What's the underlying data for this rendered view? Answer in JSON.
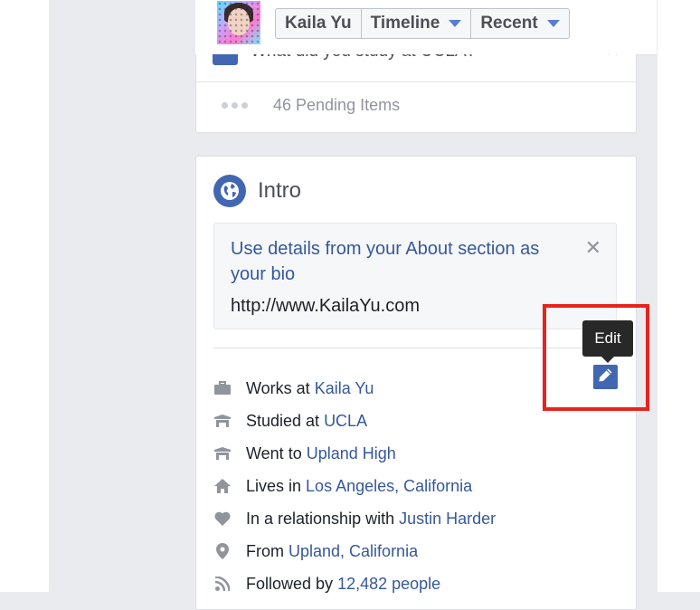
{
  "header": {
    "profile_name": "Kaila Yu",
    "timeline_label": "Timeline",
    "recent_label": "Recent"
  },
  "composer": {
    "cutoff_prompt": "What did you study at UCLA?",
    "pending_items": "46 Pending Items"
  },
  "intro": {
    "title": "Intro",
    "bio_suggestion": "Use details from your About section as your bio",
    "bio_url": "http://www.KailaYu.com",
    "edit_tooltip": "Edit",
    "items": [
      {
        "icon": "briefcase-icon",
        "prefix": "Works at ",
        "link": "Kaila Yu"
      },
      {
        "icon": "graduation-cap-icon",
        "prefix": "Studied at ",
        "link": "UCLA"
      },
      {
        "icon": "graduation-cap-icon",
        "prefix": "Went to ",
        "link": "Upland High"
      },
      {
        "icon": "house-icon",
        "prefix": "Lives in ",
        "link": "Los Angeles, California"
      },
      {
        "icon": "heart-icon",
        "prefix": "In a relationship with ",
        "link": "Justin Harder"
      },
      {
        "icon": "map-pin-icon",
        "prefix": "From ",
        "link": "Upland, California"
      },
      {
        "icon": "rss-icon",
        "prefix": "Followed by ",
        "link": "12,482 people"
      }
    ]
  },
  "colors": {
    "link": "#365899",
    "accent": "#4267b2",
    "highlight": "#e8231d",
    "tooltip_bg": "#282828"
  }
}
